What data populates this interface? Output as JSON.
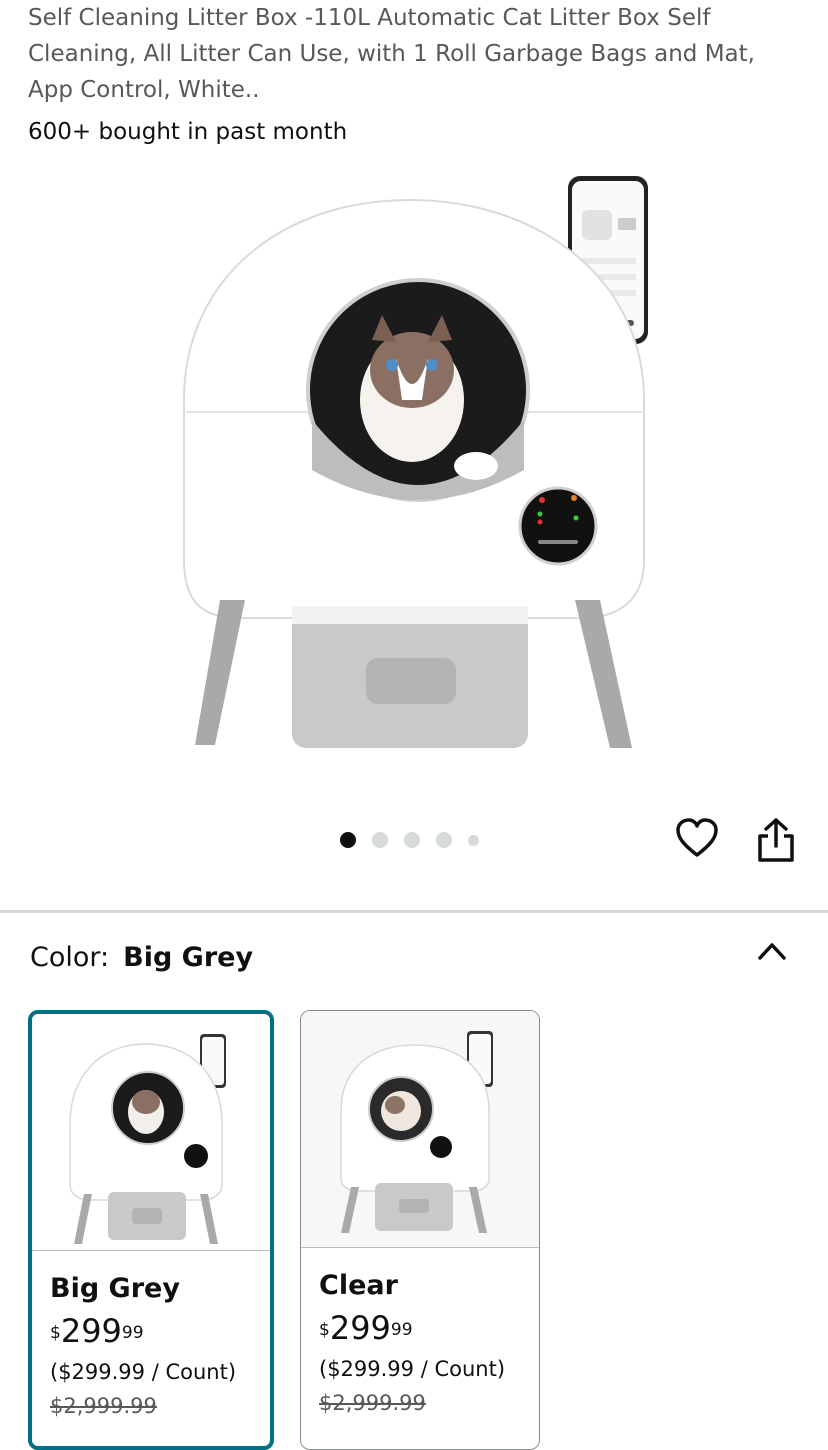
{
  "product": {
    "title": "Self Cleaning Litter Box -110L Automatic Cat Litter Box Self Cleaning, All Litter Can Use, with 1 Roll Garbage Bags and Mat, App Control, White..",
    "bought_text": "600+ bought in past month"
  },
  "gallery": {
    "image_count": 5,
    "active_index": 0,
    "icons": {
      "favorite": "heart-icon",
      "share": "share-icon"
    }
  },
  "color_selector": {
    "label": "Color:",
    "selected_value": "Big Grey",
    "toggle_icon": "chevron-up-icon",
    "options": [
      {
        "name": "Big Grey",
        "currency": "$",
        "price_whole": "299",
        "price_fraction": "99",
        "unit_price": "($299.99 / Count)",
        "list_price": "$2,999.99",
        "selected": true
      },
      {
        "name": "Clear",
        "currency": "$",
        "price_whole": "299",
        "price_fraction": "99",
        "unit_price": "($299.99 / Count)",
        "list_price": "$2,999.99",
        "selected": false
      }
    ]
  },
  "colors": {
    "selected_border": "#007185",
    "text": "#0f1111",
    "muted_text": "#565959",
    "divider": "#d5d9d9",
    "dot_active": "#0f1111",
    "dot_inactive": "#d5d9d9"
  }
}
